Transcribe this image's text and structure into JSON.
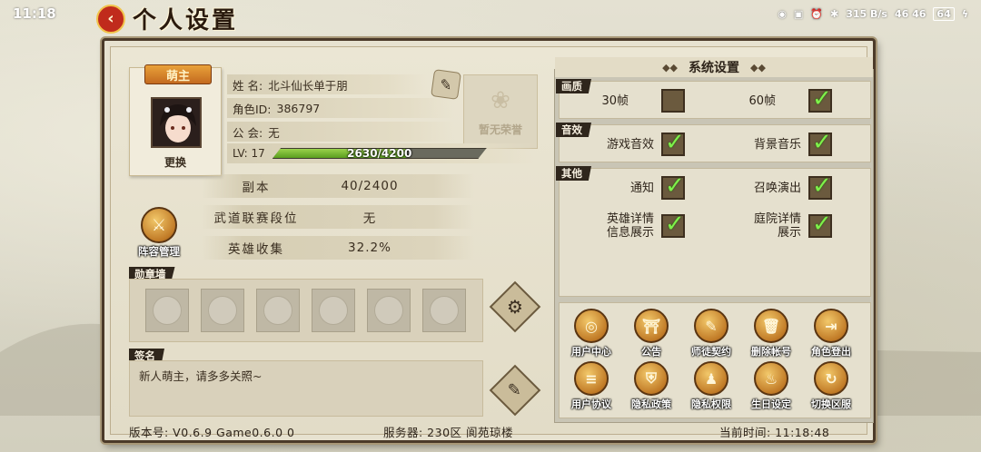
{
  "status": {
    "time": "11:18",
    "speed": "315 B/s",
    "signal": "46 46",
    "battery": "64"
  },
  "title": "个人设置",
  "profile": {
    "badge": "萌主",
    "change_label": "更换",
    "name_key": "姓  名:",
    "name_value": "北斗仙长单于朋",
    "id_key": "角色ID:",
    "id_value": "386797",
    "guild_key": "公  会:",
    "guild_value": "无",
    "honor_label": "暂无荣誉",
    "lv_label": "LV: 17",
    "xp_text": "2630/4200",
    "xp_fraction": 0.626
  },
  "stats": [
    {
      "key": "副本",
      "value": "40/2400"
    },
    {
      "key": "武道联赛段位",
      "value": "无"
    },
    {
      "key": "英雄收集",
      "value": "32.2%"
    }
  ],
  "lineup_label": "阵容管理",
  "medal_wall_label": "勋章墙",
  "signature_label": "签名",
  "signature_text": "新人萌主，请多多关照~",
  "footer": {
    "version": "版本号: V0.6.9 Game0.6.0 0",
    "server": "服务器: 230区 阆苑琼楼",
    "time": "当前时间: 11:18:48"
  },
  "settings": {
    "header": "系统设置",
    "sections": {
      "quality": "画质",
      "sound": "音效",
      "other": "其他"
    },
    "fps30": "30帧",
    "fps60": "60帧",
    "game_sound": "游戏音效",
    "bg_music": "背景音乐",
    "notify": "通知",
    "summon_show": "召唤演出",
    "hero_detail_1": "英雄详情",
    "hero_detail_2": "信息展示",
    "yard_detail_1": "庭院详情",
    "yard_detail_2": "展示"
  },
  "actions": [
    {
      "label": "用户中心",
      "icon": "user-center-icon",
      "glyph": "◎"
    },
    {
      "label": "公告",
      "icon": "announcement-icon",
      "glyph": "⛩"
    },
    {
      "label": "师徒契约",
      "icon": "contract-icon",
      "glyph": "✎"
    },
    {
      "label": "删除帐号",
      "icon": "trash-icon",
      "glyph": "🗑"
    },
    {
      "label": "角色登出",
      "icon": "logout-icon",
      "glyph": "⇥"
    },
    {
      "label": "用户协议",
      "icon": "document-icon",
      "glyph": "≡"
    },
    {
      "label": "隐私政策",
      "icon": "shield-icon",
      "glyph": "⛨"
    },
    {
      "label": "隐私权限",
      "icon": "person-lock-icon",
      "glyph": "♟"
    },
    {
      "label": "生日设定",
      "icon": "cake-icon",
      "glyph": "♨"
    },
    {
      "label": "切换区服",
      "icon": "switch-server-icon",
      "glyph": "↻"
    }
  ]
}
